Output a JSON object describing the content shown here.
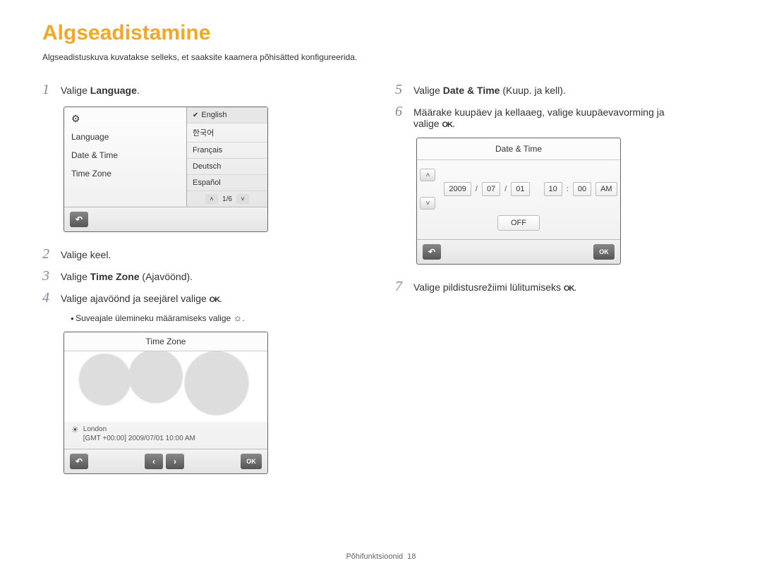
{
  "title": "Algseadistamine",
  "intro": "Algseadistuskuva kuvatakse selleks, et saaksite kaamera põhisätted konfigureerida.",
  "steps": {
    "s1_pre": "Valige ",
    "s1_bold": "Language",
    "s1_post": ".",
    "s2": "Valige keel.",
    "s3_pre": "Valige ",
    "s3_bold": "Time Zone",
    "s3_post": " (Ajavöönd).",
    "s4_pre": "Valige ajavöönd ja seejärel valige ",
    "s4_sub_pre": "Suveajale ülemineku määramiseks valige ",
    "s5_pre": "Valige ",
    "s5_bold": "Date & Time",
    "s5_post": " (Kuup. ja kell).",
    "s6_line1": "Määrake kuupäev ja kellaaeg, valige kuupäevavorming ja",
    "s6_line2_pre": "valige ",
    "s7_pre": "Valige pildistusrežiimi lülitumiseks "
  },
  "lang_panel": {
    "left": {
      "gear": "⚙",
      "row1": "Language",
      "row2": "Date & Time",
      "row3": "Time Zone"
    },
    "opts": [
      "English",
      "한국어",
      "Français",
      "Deutsch",
      "Español"
    ],
    "pager": "1/6"
  },
  "tz_panel": {
    "header": "Time Zone",
    "city": "London",
    "detail": "[GMT +00:00] 2009/07/01 10:00 AM"
  },
  "dt_panel": {
    "header": "Date & Time",
    "year": "2009",
    "month": "07",
    "day": "01",
    "hour": "10",
    "minute": "00",
    "ampm": "AM",
    "off": "OFF"
  },
  "ok_label": "OK",
  "footer": {
    "section": "Põhifunktsioonid",
    "page": "18"
  }
}
